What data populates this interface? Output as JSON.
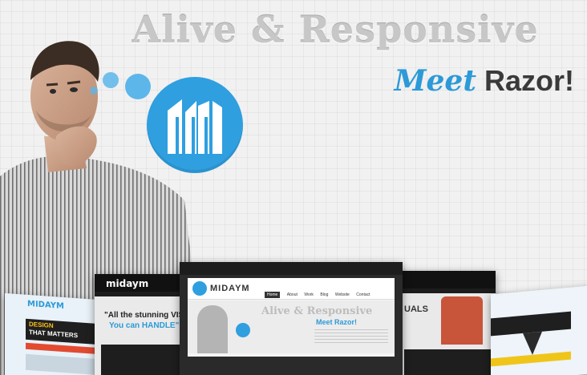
{
  "hero": {
    "headline": "Alive & Responsive",
    "tagline_meet": "Meet",
    "tagline_razor": "Razor!"
  },
  "preview": {
    "brand": "MIDAYM",
    "brand_left": "midaym",
    "left_headline_1": "\"All the stunning VIS",
    "left_headline_2": "You can HANDLE\"",
    "far_left_banner_1": "DESIGN",
    "far_left_banner_2": "THAT MATTERS",
    "center_headline": "Alive & Responsive",
    "center_sub": "Meet Razor!",
    "right_fragment": "UALS",
    "nav": [
      "Home",
      "About",
      "Work",
      "Blog",
      "Website",
      "Contact"
    ]
  },
  "colors": {
    "accent": "#2c9ad8",
    "dark": "#3a3a3a"
  }
}
